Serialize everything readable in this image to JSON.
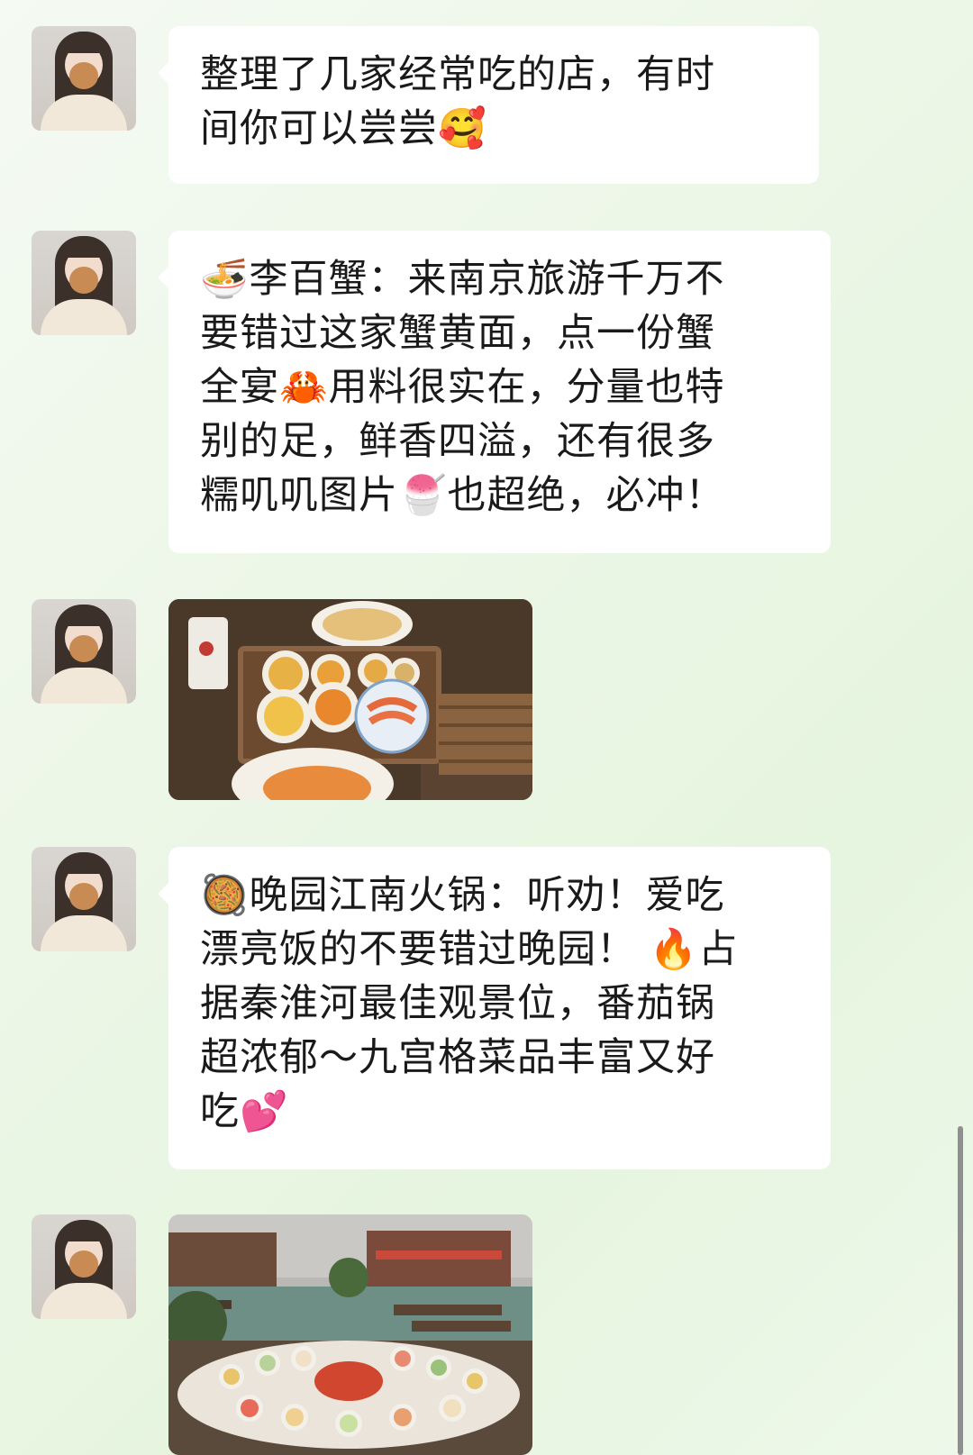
{
  "messages": [
    {
      "type": "text",
      "text": "整理了几家经常吃的店，有时\n间你可以尝尝🥰"
    },
    {
      "type": "text",
      "text": "🍜李百蟹：来南京旅游千万不\n要错过这家蟹黄面，点一份蟹\n全宴🦀用料很实在，分量也特\n别的足，鲜香四溢，还有很多\n糯叽叽图片🍧也超绝，必冲！"
    },
    {
      "type": "image"
    },
    {
      "type": "text",
      "text": "🥘晚园江南火锅：听劝！爱吃\n漂亮饭的不要错过晚园！ 🔥占\n据秦淮河最佳观景位，番茄锅\n超浓郁～九宫格菜品丰富又好\n吃💕"
    },
    {
      "type": "image"
    }
  ],
  "colors": {
    "background": "#e9f6e3",
    "bubble": "#ffffff",
    "text": "#1a1a1a"
  }
}
